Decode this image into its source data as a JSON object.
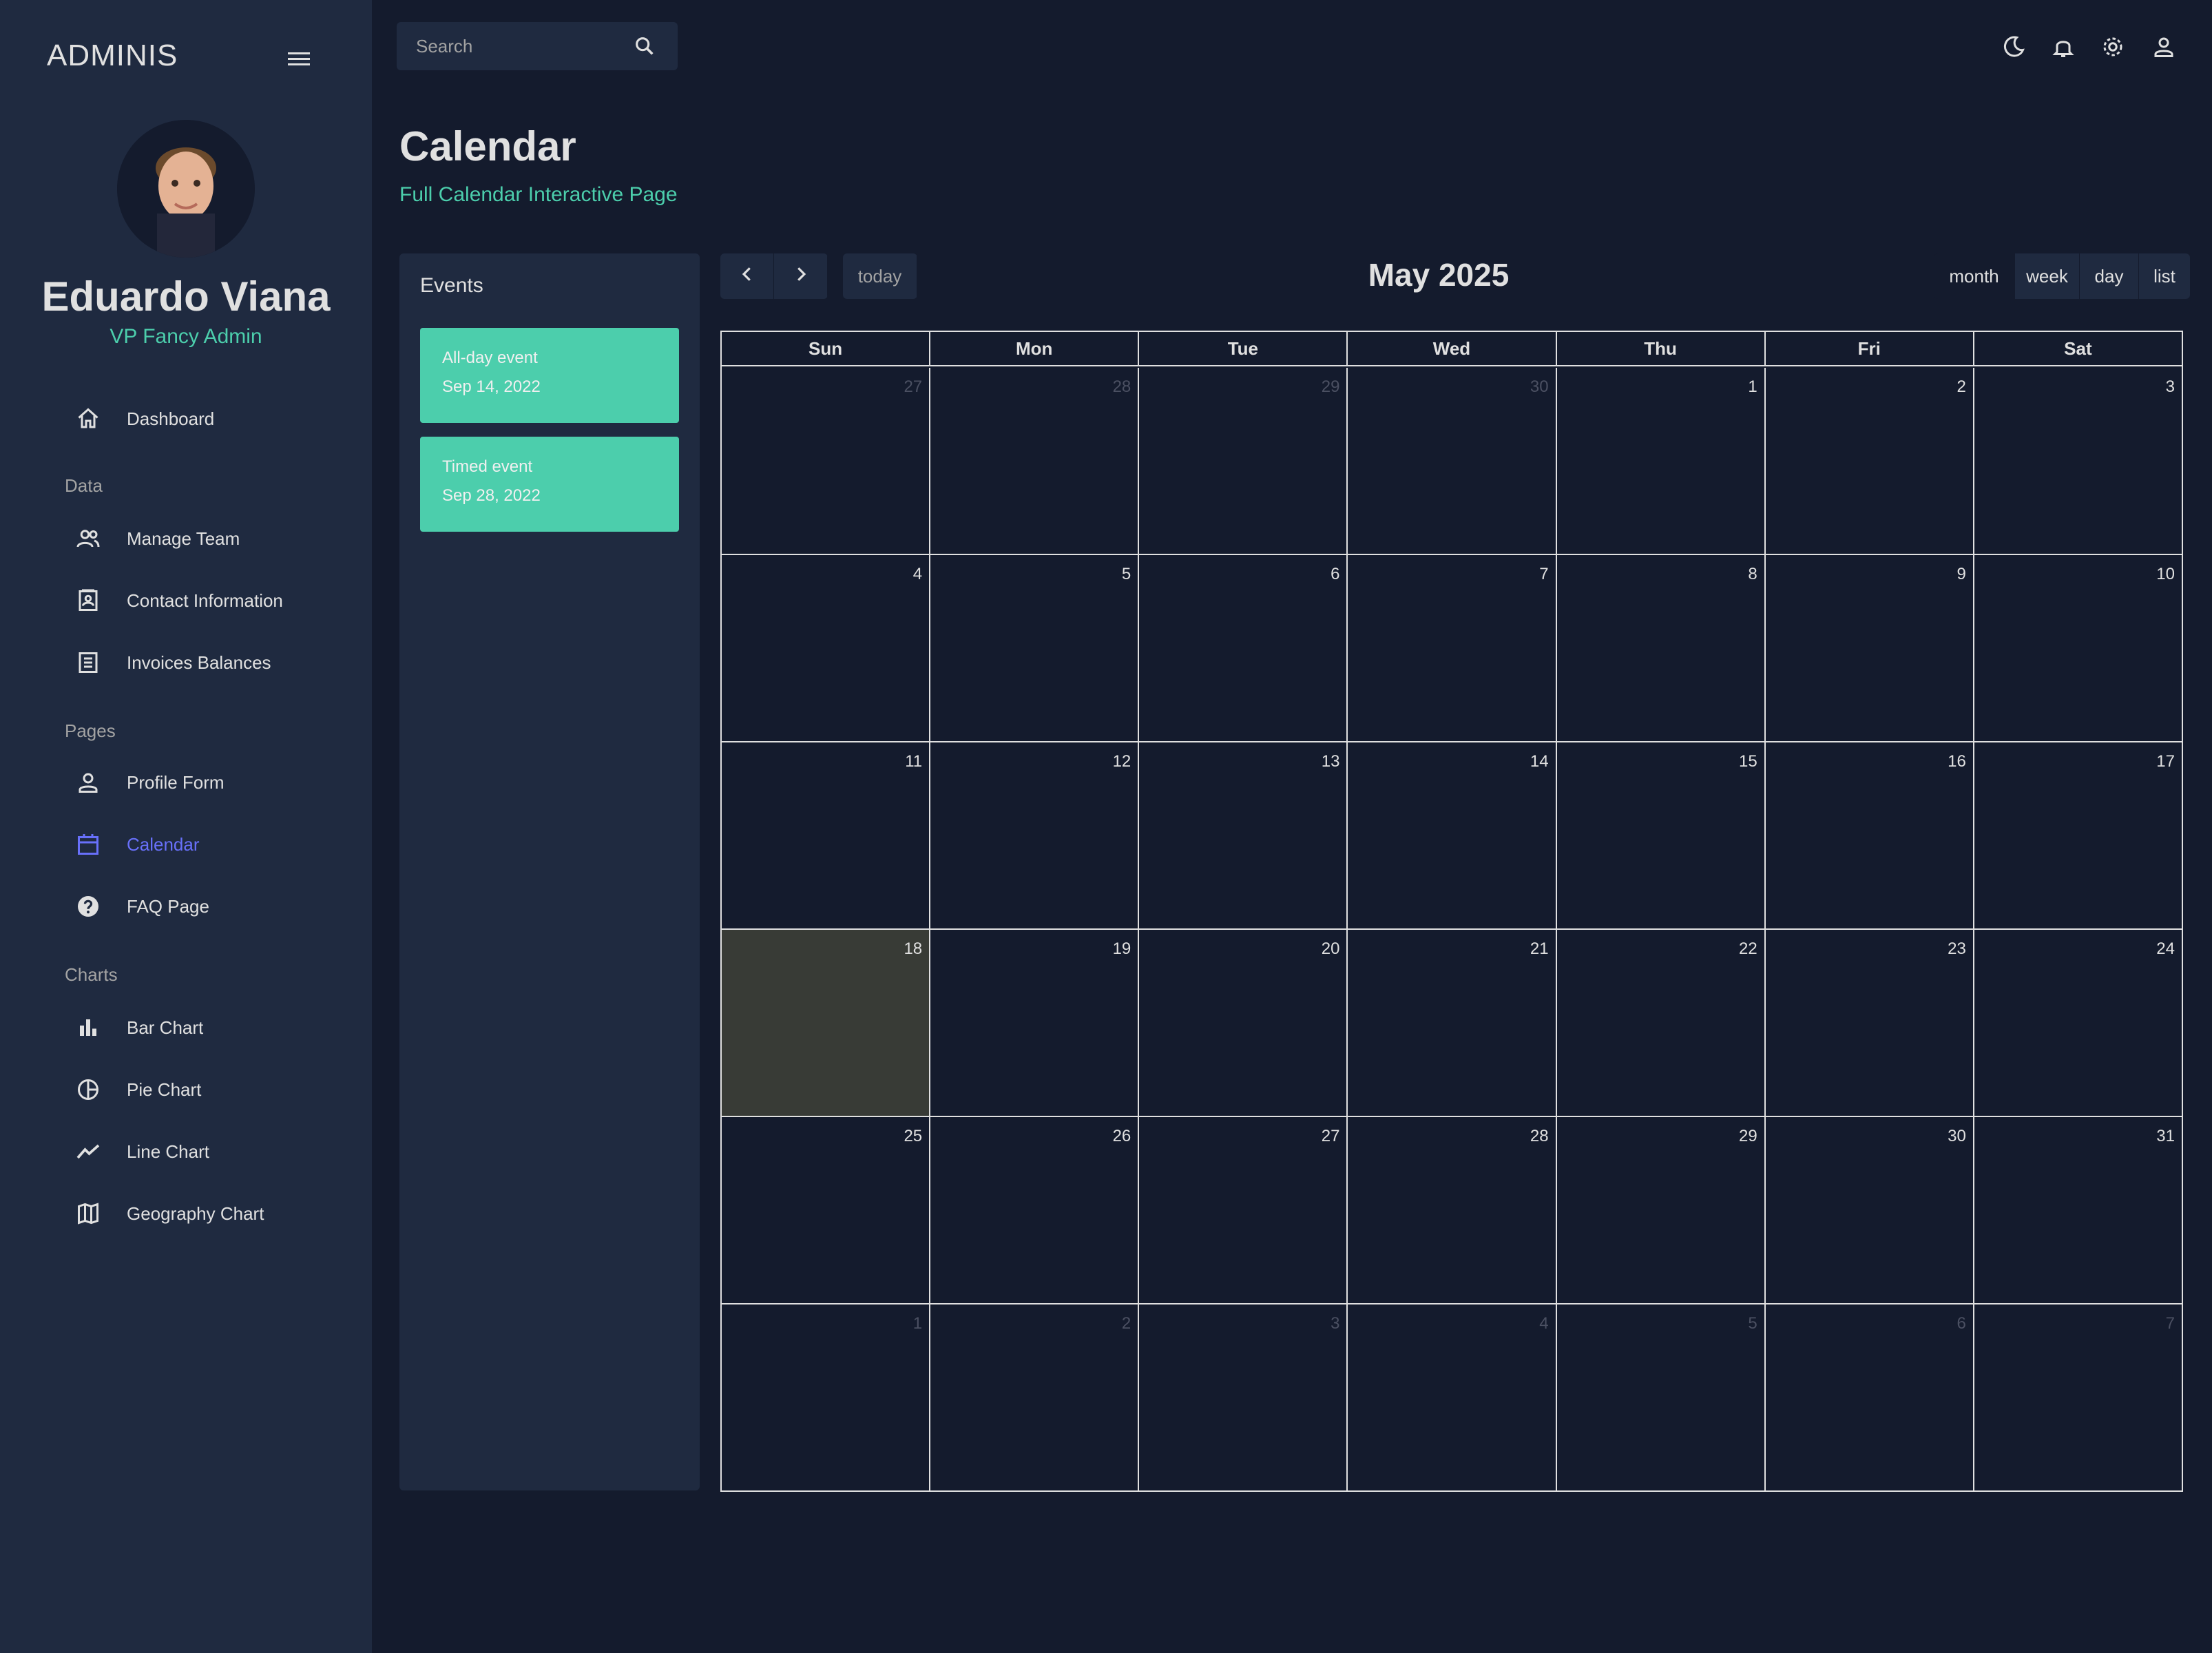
{
  "sidebar": {
    "brand": "ADMINIS",
    "user_name": "Eduardo Viana",
    "user_role": "VP Fancy Admin",
    "sections": [
      {
        "label": "Data"
      },
      {
        "label": "Pages"
      },
      {
        "label": "Charts"
      }
    ],
    "items": [
      {
        "label": "Dashboard",
        "icon": "home-icon"
      },
      {
        "label": "Manage Team",
        "icon": "team-icon"
      },
      {
        "label": "Contact Information",
        "icon": "contacts-icon"
      },
      {
        "label": "Invoices Balances",
        "icon": "receipt-icon"
      },
      {
        "label": "Profile Form",
        "icon": "person-icon"
      },
      {
        "label": "Calendar",
        "icon": "calendar-icon"
      },
      {
        "label": "FAQ Page",
        "icon": "help-icon"
      },
      {
        "label": "Bar Chart",
        "icon": "bar-chart-icon"
      },
      {
        "label": "Pie Chart",
        "icon": "pie-chart-icon"
      },
      {
        "label": "Line Chart",
        "icon": "line-chart-icon"
      },
      {
        "label": "Geography Chart",
        "icon": "map-icon"
      }
    ],
    "active_item": "Calendar"
  },
  "topbar": {
    "search_placeholder": "Search",
    "icons": [
      "dark-mode-icon",
      "notifications-icon",
      "settings-icon",
      "profile-icon"
    ]
  },
  "header": {
    "title": "Calendar",
    "subtitle": "Full Calendar Interactive Page"
  },
  "events": {
    "title": "Events",
    "items": [
      {
        "title": "All-day event",
        "date": "Sep 14, 2022"
      },
      {
        "title": "Timed event",
        "date": "Sep 28, 2022"
      }
    ]
  },
  "calendar": {
    "title": "May 2025",
    "today_label": "today",
    "views": [
      "month",
      "week",
      "day",
      "list"
    ],
    "active_view": "month",
    "weekdays": [
      "Sun",
      "Mon",
      "Tue",
      "Wed",
      "Thu",
      "Fri",
      "Sat"
    ],
    "weeks": [
      [
        "27",
        "28",
        "29",
        "30",
        "1",
        "2",
        "3"
      ],
      [
        "4",
        "5",
        "6",
        "7",
        "8",
        "9",
        "10"
      ],
      [
        "11",
        "12",
        "13",
        "14",
        "15",
        "16",
        "17"
      ],
      [
        "18",
        "19",
        "20",
        "21",
        "22",
        "23",
        "24"
      ],
      [
        "25",
        "26",
        "27",
        "28",
        "29",
        "30",
        "31"
      ],
      [
        "1",
        "2",
        "3",
        "4",
        "5",
        "6",
        "7"
      ]
    ],
    "today_date": "18",
    "colors": {
      "today_bg": "#383b36",
      "accent": "#4cceac",
      "active_nav": "#6870fa"
    }
  }
}
